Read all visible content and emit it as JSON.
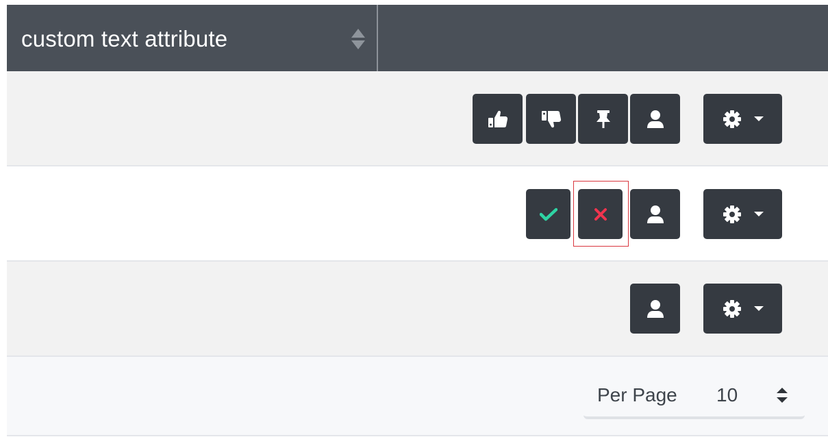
{
  "table": {
    "header": {
      "column_label": "custom text attribute"
    },
    "rows": [
      {
        "actions": [
          "thumbs-up",
          "thumbs-down",
          "pin",
          "user",
          "settings-dropdown"
        ]
      },
      {
        "actions": [
          "approve",
          "reject",
          "user",
          "settings-dropdown"
        ]
      },
      {
        "actions": [
          "user",
          "settings-dropdown"
        ]
      }
    ]
  },
  "pagination": {
    "per_page_label": "Per Page",
    "per_page_value": "10"
  },
  "colors": {
    "header_bg": "#4a5058",
    "button_bg": "#353a41",
    "approve_green": "#2ed3a3",
    "reject_red": "#f0344e",
    "focus_outline": "#d9363e"
  }
}
